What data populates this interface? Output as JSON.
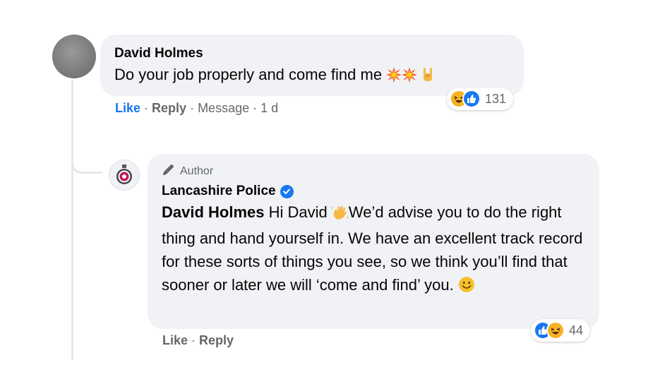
{
  "comment": {
    "author": "David Holmes",
    "text": "Do your job properly and come find me",
    "reactions_count": "131",
    "actions": {
      "like": "Like",
      "reply": "Reply",
      "message": "Message",
      "time": "1 d"
    }
  },
  "reply": {
    "author_tag": "Author",
    "author": "Lancashire Police",
    "verified": true,
    "mention": "David Holmes",
    "text_greeting": " Hi David ",
    "text_body": "We’d advise you to do the right thing and hand yourself in. We have an excellent track record for these sorts of things you see, so we think you’ll find that sooner or later we will ‘come and find’ you. ",
    "reactions_count": "44",
    "actions": {
      "like": "Like",
      "reply": "Reply"
    }
  },
  "icons": {
    "comment_emojis": [
      "collision-icon",
      "collision-icon",
      "rock-on-icon"
    ],
    "reply_emojis": [
      "waving-hand-icon",
      "smiling-face-icon"
    ],
    "reactions_1": [
      "haha-reaction-icon",
      "like-reaction-icon"
    ],
    "reactions_2": [
      "like-reaction-icon",
      "haha-reaction-icon"
    ]
  },
  "colors": {
    "bubble": "#f0f2f5",
    "like_blue": "#1877f2",
    "secondary_text": "#65676b",
    "haha_yellow": "#f7b125"
  }
}
